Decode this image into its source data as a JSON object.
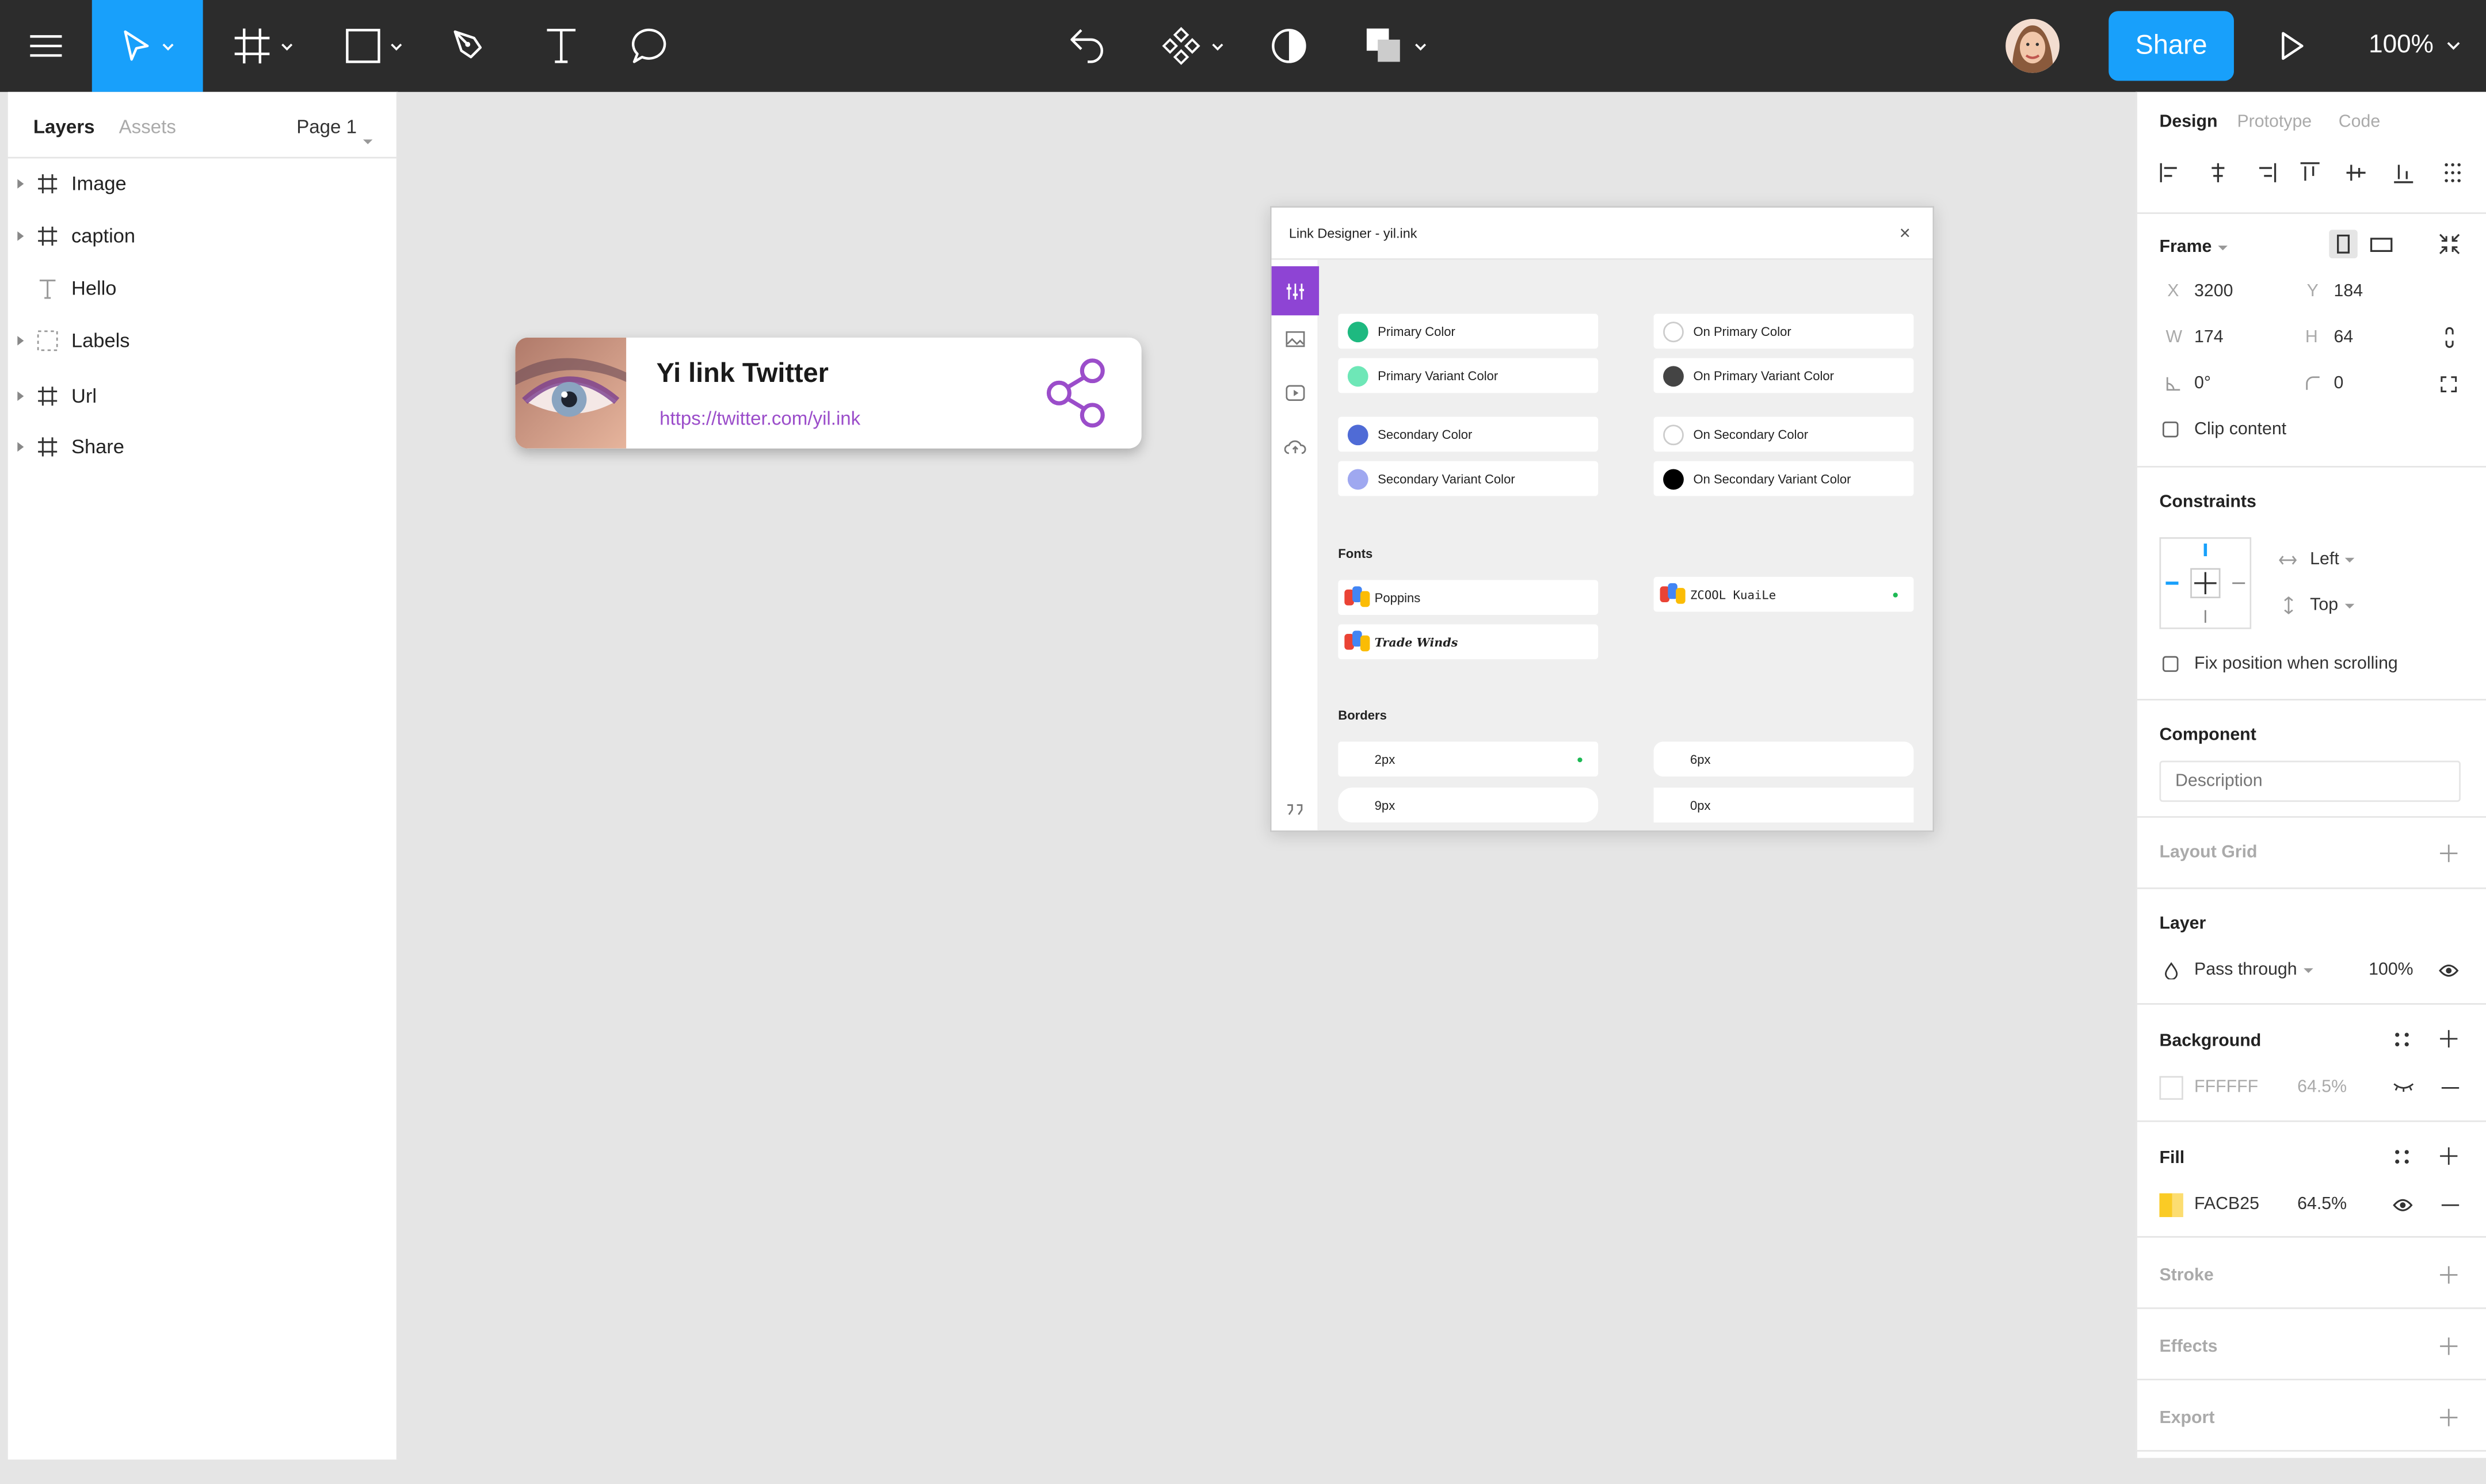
{
  "toolbar": {
    "share_label": "Share",
    "zoom": "100%",
    "icons": [
      "menu-icon",
      "move-tool-icon",
      "frame-tool-icon",
      "shape-tool-icon",
      "pen-tool-icon",
      "text-tool-icon",
      "comment-tool-icon",
      "plugins-icon",
      "component-icon",
      "mask-icon",
      "boolean-icon",
      "avatar",
      "play-icon"
    ]
  },
  "layers_panel": {
    "tabs": [
      "Layers",
      "Assets"
    ],
    "page": "Page 1",
    "layers": [
      {
        "name": "Image",
        "kind": "frame"
      },
      {
        "name": "caption",
        "kind": "frame"
      },
      {
        "name": "Hello",
        "kind": "text"
      },
      {
        "name": "Labels",
        "kind": "group"
      },
      {
        "name": "Url",
        "kind": "frame"
      },
      {
        "name": "Share",
        "kind": "frame"
      }
    ]
  },
  "card": {
    "title": "Yi link Twitter",
    "url": "https://twitter.com/yil.ink",
    "accent": "#9b4dca"
  },
  "plugin": {
    "title": "Link Designer - yil.ink",
    "close": "×",
    "colors_left": [
      {
        "label": "Primary Color",
        "color": "#1eb980"
      },
      {
        "label": "Primary Variant Color",
        "color": "#6ee7b7"
      },
      {
        "label": "Secondary Color",
        "color": "#4f6bd6"
      },
      {
        "label": "Secondary Variant Color",
        "color": "#9fa8f0"
      }
    ],
    "colors_right": [
      {
        "label": "On Primary Color",
        "color": "#ffffff"
      },
      {
        "label": "On Primary Variant Color",
        "color": "#444444"
      },
      {
        "label": "On Secondary Color",
        "color": "#ffffff"
      },
      {
        "label": "On Secondary Variant Color",
        "color": "#000000"
      }
    ],
    "fonts_title": "Fonts",
    "fonts": [
      "Poppins",
      "Trade Winds",
      "ZCOOL KuaiLe"
    ],
    "borders_title": "Borders",
    "borders": [
      "2px",
      "6px",
      "9px",
      "0px"
    ],
    "tab_accent": "#8e44d4"
  },
  "design_panel": {
    "tabs": [
      "Design",
      "Prototype",
      "Code"
    ],
    "frame_title": "Frame",
    "x_label": "X",
    "x": "3200",
    "y_label": "Y",
    "y": "184",
    "w_label": "W",
    "w": "174",
    "h_label": "H",
    "h": "64",
    "rotation": "0°",
    "radius": "0",
    "clip_content": "Clip content",
    "constraints_title": "Constraints",
    "constraint_h": "Left",
    "constraint_v": "Top",
    "fix_position": "Fix position when scrolling",
    "component_title": "Component",
    "description_placeholder": "Description",
    "layout_grid_title": "Layout Grid",
    "layer_title": "Layer",
    "blend_mode": "Pass through",
    "layer_opacity": "100%",
    "background_title": "Background",
    "background_hex": "FFFFFF",
    "background_opacity": "64.5%",
    "fill_title": "Fill",
    "fill_hex": "FACB25",
    "fill_opacity": "64.5%",
    "fill_color": "#facb25",
    "stroke_title": "Stroke",
    "effects_title": "Effects",
    "export_title": "Export",
    "accent": "#18a0fb"
  }
}
